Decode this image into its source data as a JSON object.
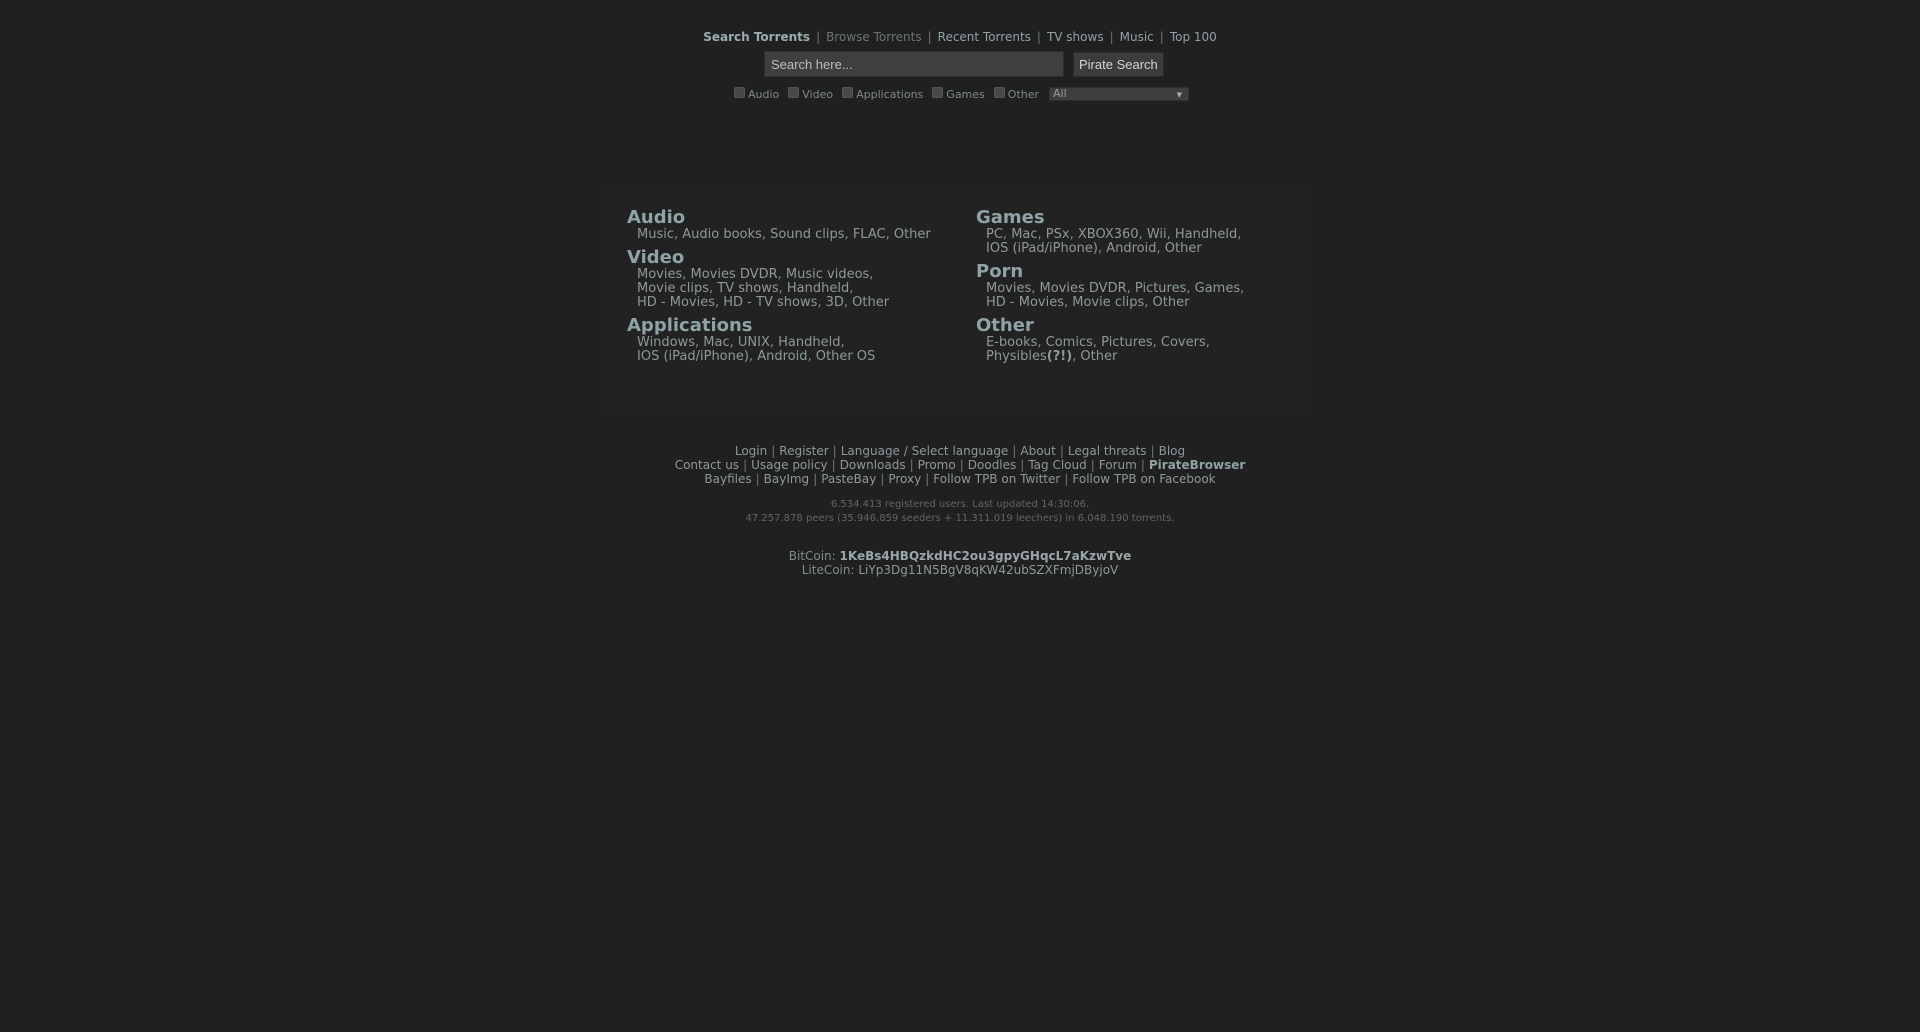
{
  "nav": {
    "items": [
      {
        "label": "Search Torrents"
      },
      {
        "label": "Browse Torrents"
      },
      {
        "label": "Recent Torrents"
      },
      {
        "label": "TV shows"
      },
      {
        "label": "Music"
      },
      {
        "label": "Top 100"
      }
    ],
    "separator": "|"
  },
  "search": {
    "placeholder": "Search here...",
    "button_label": "Pirate Search"
  },
  "filters": {
    "options": [
      {
        "label": "Audio",
        "checked": false
      },
      {
        "label": "Video",
        "checked": false
      },
      {
        "label": "Applications",
        "checked": false
      },
      {
        "label": "Games",
        "checked": false
      },
      {
        "label": "Other",
        "checked": false
      }
    ],
    "select_value": "All"
  },
  "categories": {
    "audio": {
      "title": "Audio",
      "items": [
        "Music",
        "Audio books",
        "Sound clips",
        "FLAC",
        "Other"
      ]
    },
    "video": {
      "title": "Video",
      "items": [
        "Movies",
        "Movies DVDR",
        "Music videos",
        "Movie clips",
        "TV shows",
        "Handheld",
        "HD - Movies",
        "HD - TV shows",
        "3D",
        "Other"
      ]
    },
    "applications": {
      "title": "Applications",
      "items": [
        "Windows",
        "Mac",
        "UNIX",
        "Handheld",
        "IOS (iPad/iPhone)",
        "Android",
        "Other OS"
      ]
    },
    "games": {
      "title": "Games",
      "items": [
        "PC",
        "Mac",
        "PSx",
        "XBOX360",
        "Wii",
        "Handheld",
        "IOS (iPad/iPhone)",
        "Android",
        "Other"
      ]
    },
    "porn": {
      "title": "Porn",
      "items": [
        "Movies",
        "Movies DVDR",
        "Pictures",
        "Games",
        "HD - Movies",
        "Movie clips",
        "Other"
      ]
    },
    "other": {
      "title": "Other",
      "items": [
        "E-books",
        "Comics",
        "Pictures",
        "Covers",
        "Physibles",
        "(?!)",
        "Other"
      ]
    }
  },
  "footer": {
    "row1": [
      "Login",
      "Register",
      "Language / Select language",
      "About",
      "Legal threats",
      "Blog"
    ],
    "row2": [
      "Contact us",
      "Usage policy",
      "Downloads",
      "Promo",
      "Doodles",
      "Tag Cloud",
      "Forum",
      "PirateBrowser"
    ],
    "row3": [
      "Bayfiles",
      "BayImg",
      "PasteBay",
      "Proxy",
      "Follow TPB on Twitter",
      "Follow TPB on Facebook"
    ]
  },
  "stats": {
    "line1": "6.534.413 registered users. Last updated 14:30:06.",
    "line2": "47.257.878 peers (35.946.859 seeders + 11.311.019 leechers) in 6.048.190 torrents."
  },
  "coins": {
    "bitcoin_label": "BitCoin:",
    "bitcoin_address": "1KeBs4HBQzkdHC2ou3gpyGHqcL7aKzwTve",
    "litecoin_label": "LiteCoin:",
    "litecoin_address": "LiYp3Dg11N5BgV8qKW42ubSZXFmjDByjoV"
  },
  "colors": {
    "background": "#202020",
    "link": "#8fa3a7",
    "text": "#7f8c8e"
  }
}
